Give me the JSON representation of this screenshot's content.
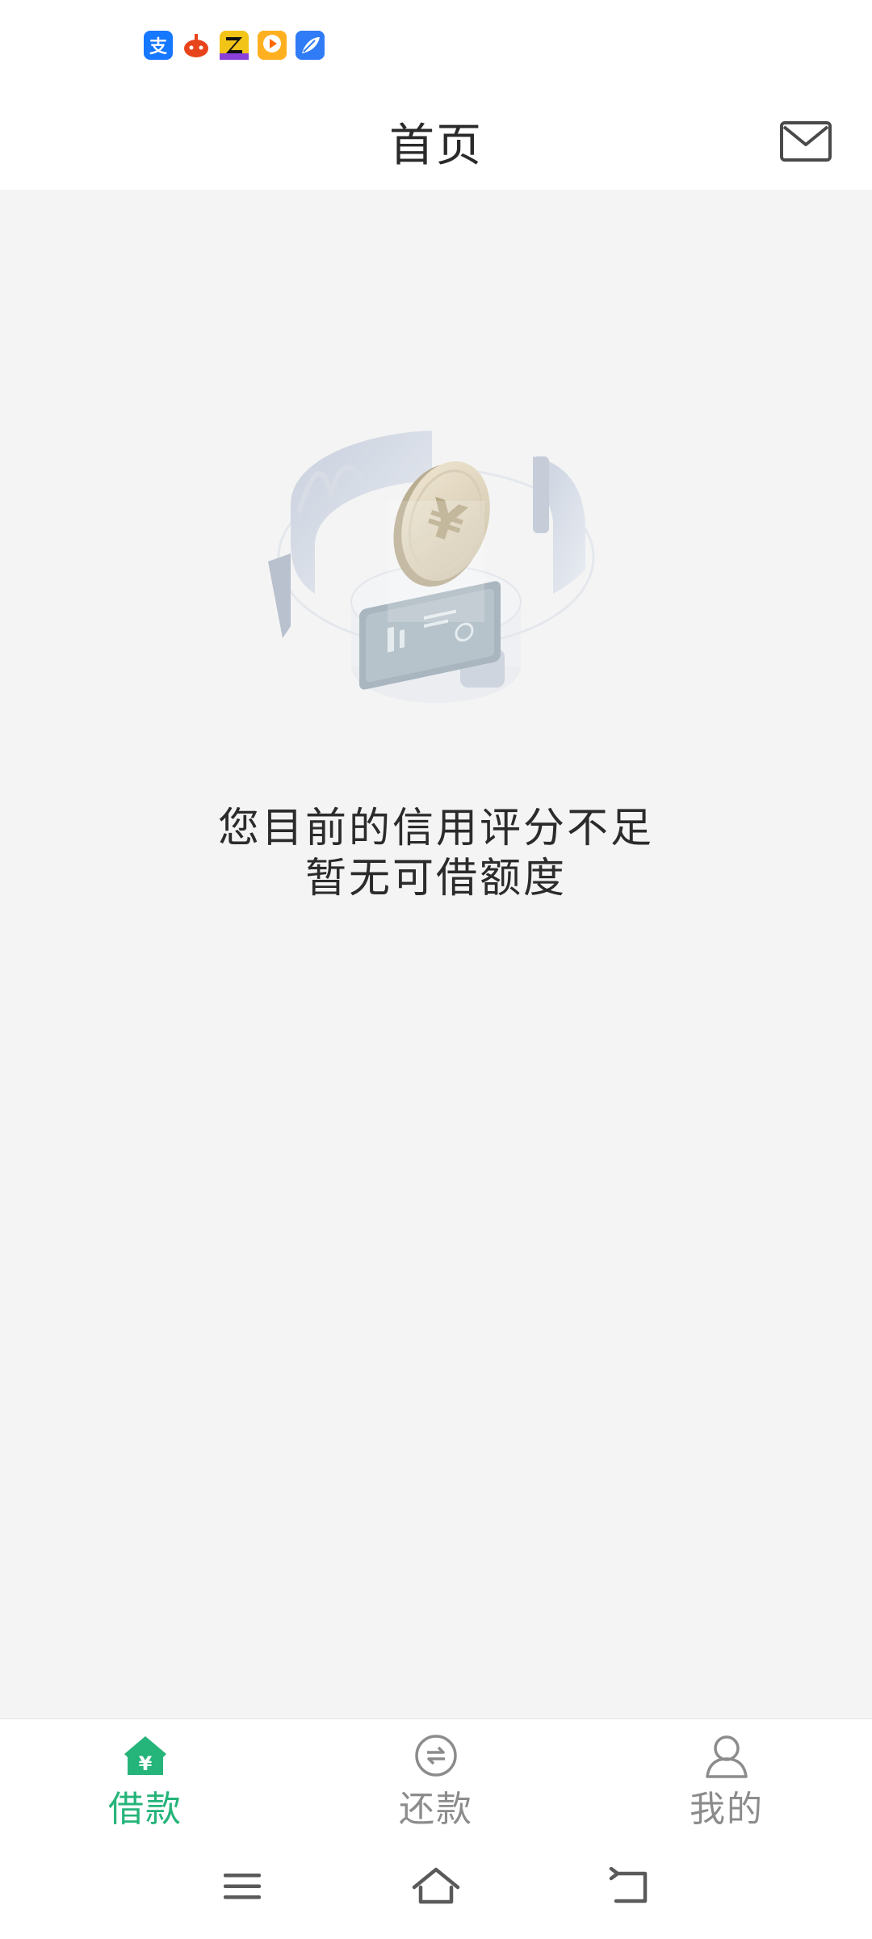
{
  "status_bar": {
    "notification_icons": [
      {
        "name": "alipay-icon",
        "glyph": "支",
        "color": "#1677ff"
      },
      {
        "name": "taobao-icon",
        "glyph": "●",
        "color": "#e8441c"
      },
      {
        "name": "game-icon",
        "glyph": "Z",
        "color": "#6c3bd6"
      },
      {
        "name": "video-icon",
        "glyph": "▶",
        "color": "#ff9f1c"
      },
      {
        "name": "feather-icon",
        "glyph": "◢",
        "color": "#2f7cf6"
      }
    ]
  },
  "header": {
    "title": "首页",
    "mail_icon": "mail-icon"
  },
  "main": {
    "illustration_icon": "yuan-coin-illustration",
    "message_line1": "您目前的信用评分不足",
    "message_line2": "暂无可借额度"
  },
  "tab_bar": {
    "tabs": [
      {
        "label": "借款",
        "icon": "loan-house-icon",
        "active": true
      },
      {
        "label": "还款",
        "icon": "repay-exchange-icon",
        "active": false
      },
      {
        "label": "我的",
        "icon": "user-profile-icon",
        "active": false
      }
    ],
    "active_color": "#25b47a",
    "inactive_color": "#8c8c8c"
  },
  "system_nav": {
    "buttons": [
      "menu-icon",
      "home-icon",
      "back-icon"
    ]
  }
}
